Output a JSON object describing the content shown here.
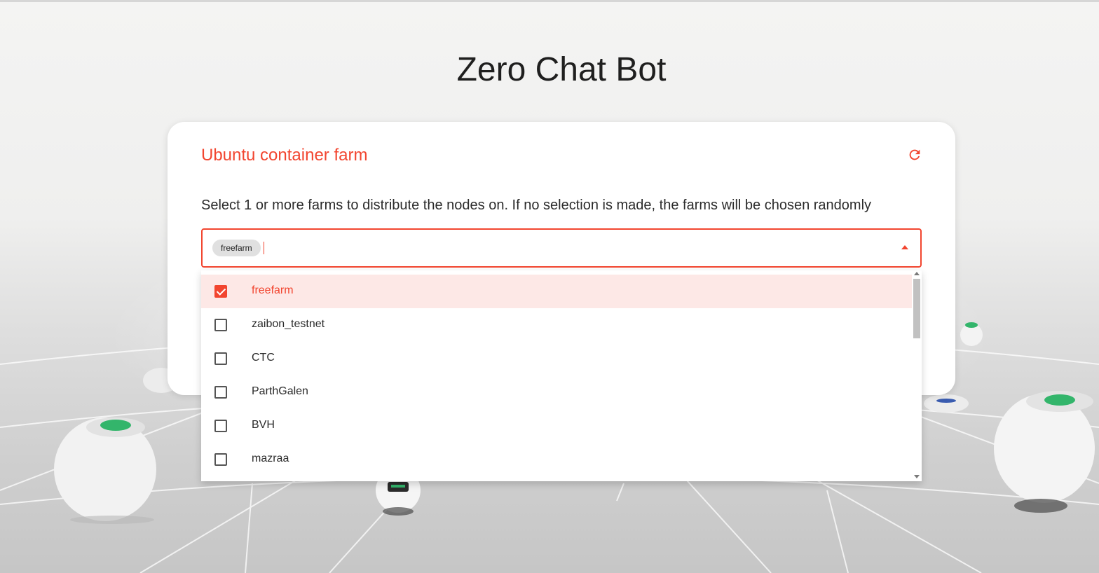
{
  "header": {
    "title": "Zero Chat Bot"
  },
  "card": {
    "title": "Ubuntu container farm",
    "refresh_icon": "refresh-icon",
    "description": "Select 1 or more farms to distribute the nodes on. If no selection is made, the farms will be chosen randomly"
  },
  "select": {
    "chips": [
      "freefarm"
    ],
    "options": [
      {
        "label": "freefarm",
        "checked": true
      },
      {
        "label": "zaibon_testnet",
        "checked": false
      },
      {
        "label": "CTC",
        "checked": false
      },
      {
        "label": "ParthGalen",
        "checked": false
      },
      {
        "label": "BVH",
        "checked": false
      },
      {
        "label": "mazraa",
        "checked": false
      }
    ]
  },
  "colors": {
    "accent": "#f2452f",
    "selected_row": "#fde8e6",
    "text": "#2b2b2b"
  }
}
